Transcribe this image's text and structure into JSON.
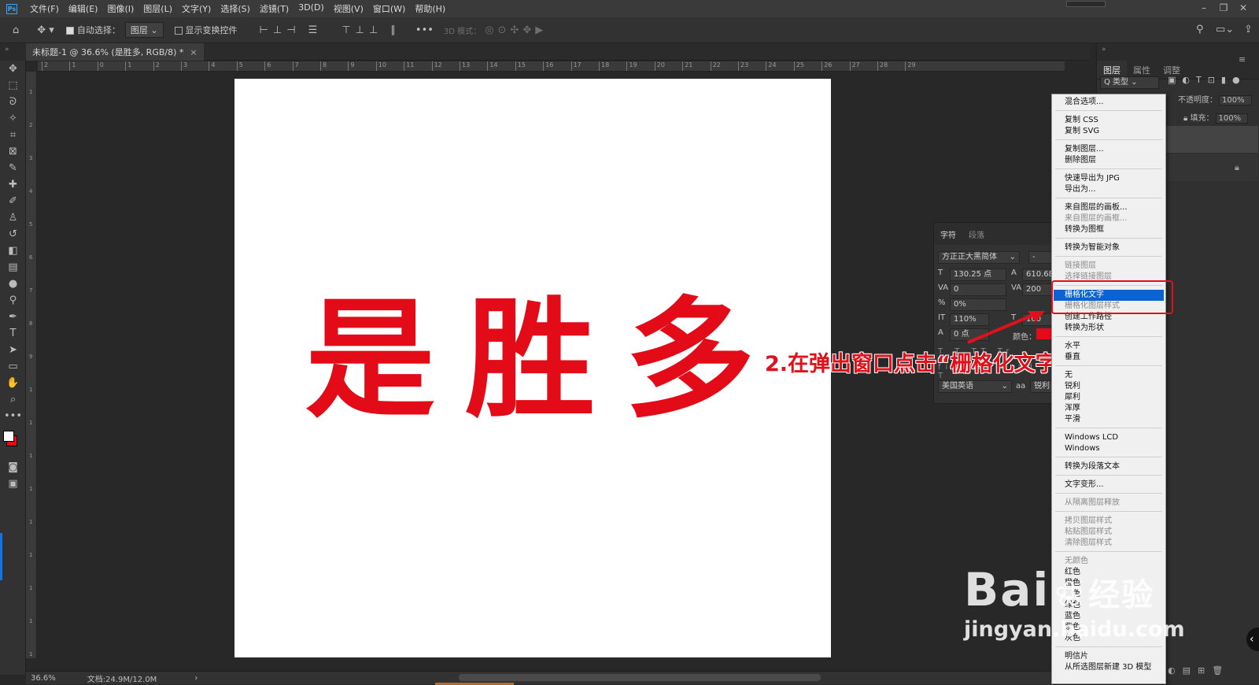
{
  "app": {
    "logo": "Ps"
  },
  "menubar": {
    "items": [
      "文件(F)",
      "编辑(E)",
      "图像(I)",
      "图层(L)",
      "文字(Y)",
      "选择(S)",
      "滤镜(T)",
      "3D(D)",
      "视图(V)",
      "窗口(W)",
      "帮助(H)"
    ]
  },
  "options": {
    "auto_select_label": "自动选择：",
    "auto_select_value": "图层",
    "show_transform_label": "显示变换控件",
    "mode_3d_label": "3D 模式："
  },
  "document": {
    "tab_title": "未标题-1 @ 36.6% (是胜多, RGB/8) *",
    "close": "×",
    "canvas_text": "是胜多"
  },
  "ruler": {
    "h_ticks": [
      "2",
      "1",
      "0",
      "1",
      "2",
      "3",
      "4",
      "5",
      "6",
      "7",
      "8",
      "9",
      "10",
      "11",
      "12",
      "13",
      "14",
      "15",
      "16",
      "17",
      "18",
      "19",
      "20",
      "21",
      "22",
      "23",
      "24",
      "25",
      "26",
      "27",
      "28",
      "29"
    ],
    "v_ticks": [
      "1",
      "2",
      "3",
      "4",
      "5",
      "6",
      "7",
      "8",
      "9",
      "1",
      "1",
      "1",
      "1",
      "1",
      "1",
      "1",
      "1",
      "1"
    ]
  },
  "status": {
    "zoom": "36.6%",
    "doc_size": "文档:24.9M/12.0M",
    "nav": "›"
  },
  "annotation": {
    "text": "2.在弹出窗口点击“栅格化文字”"
  },
  "right_panel": {
    "tabs": [
      "图层",
      "属性",
      "调整"
    ],
    "filter": "Q 类型",
    "opacity_label": "不透明度：",
    "opacity_value": "100%",
    "fill_label": "填充：",
    "fill_value": "100%"
  },
  "char_panel": {
    "tabs": [
      "字符",
      "段落"
    ],
    "font": "方正正大黑简体",
    "style": "-",
    "size": "130.25 点",
    "leading": "610.68",
    "kerning": "0",
    "tracking": "200",
    "scale_pct": "0%",
    "vscale": "110%",
    "hscale": "100",
    "baseline": "0 点",
    "color_label": "颜色：",
    "language": "美国英语",
    "aa_label": "aa",
    "aa_value": "锐利"
  },
  "context_menu": {
    "groups": [
      [
        {
          "label": "混合选项...",
          "disabled": false
        }
      ],
      [
        {
          "label": "复制 CSS",
          "disabled": false
        },
        {
          "label": "复制 SVG",
          "disabled": false
        }
      ],
      [
        {
          "label": "复制图层...",
          "disabled": false
        },
        {
          "label": "删除图层",
          "disabled": false
        }
      ],
      [
        {
          "label": "快速导出为 JPG",
          "disabled": false
        },
        {
          "label": "导出为...",
          "disabled": false
        }
      ],
      [
        {
          "label": "来自图层的画板...",
          "disabled": false
        },
        {
          "label": "来自图层的画框...",
          "disabled": true
        },
        {
          "label": "转换为图框",
          "disabled": false
        }
      ],
      [
        {
          "label": "转换为智能对象",
          "disabled": false
        }
      ],
      [
        {
          "label": "链接图层",
          "disabled": true
        },
        {
          "label": "选择链接图层",
          "disabled": true
        }
      ],
      [
        {
          "label": "栅格化文字",
          "disabled": false,
          "highlighted": true
        },
        {
          "label": "栅格化图层样式",
          "disabled": true
        },
        {
          "label": "创建工作路径",
          "disabled": false
        },
        {
          "label": "转换为形状",
          "disabled": false
        }
      ],
      [
        {
          "label": "水平",
          "disabled": false
        },
        {
          "label": "垂直",
          "disabled": false
        }
      ],
      [
        {
          "label": "无",
          "disabled": false
        },
        {
          "label": "锐利",
          "disabled": false
        },
        {
          "label": "犀利",
          "disabled": false
        },
        {
          "label": "浑厚",
          "disabled": false
        },
        {
          "label": "平滑",
          "disabled": false
        }
      ],
      [
        {
          "label": "Windows LCD",
          "disabled": false
        },
        {
          "label": "Windows",
          "disabled": false
        }
      ],
      [
        {
          "label": "转换为段落文本",
          "disabled": false
        }
      ],
      [
        {
          "label": "文字变形...",
          "disabled": false
        }
      ],
      [
        {
          "label": "从隔离图层释放",
          "disabled": true
        }
      ],
      [
        {
          "label": "拷贝图层样式",
          "disabled": true
        },
        {
          "label": "粘贴图层样式",
          "disabled": true
        },
        {
          "label": "清除图层样式",
          "disabled": true
        }
      ],
      [
        {
          "label": "无颜色",
          "disabled": true
        },
        {
          "label": "红色",
          "disabled": false
        },
        {
          "label": "橙色",
          "disabled": false
        },
        {
          "label": "黄色",
          "disabled": false
        },
        {
          "label": "绿色",
          "disabled": false
        },
        {
          "label": "蓝色",
          "disabled": false
        },
        {
          "label": "紫色",
          "disabled": false
        },
        {
          "label": "灰色",
          "disabled": false
        }
      ],
      [
        {
          "label": "明信片",
          "disabled": false
        },
        {
          "label": "从所选图层新建 3D 模型",
          "disabled": false
        }
      ]
    ]
  },
  "watermark": {
    "brand": "Bai",
    "brand2": "经验",
    "url": "jingyan.baidu.com"
  },
  "colors": {
    "accent_red": "#e30b17",
    "highlight_blue": "#0a63d0",
    "annot_red": "#e0111b"
  }
}
